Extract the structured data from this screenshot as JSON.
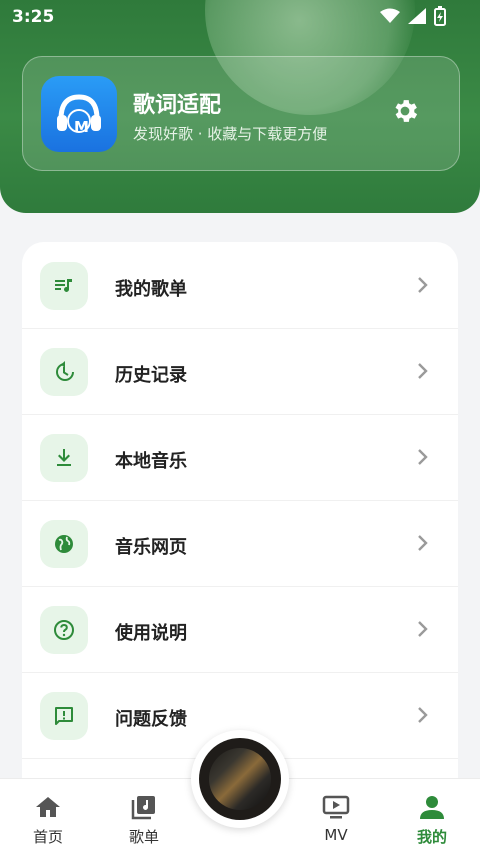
{
  "status_bar": {
    "time": "3:25"
  },
  "app": {
    "name": "歌词适配",
    "subtitle": "发现好歌 · 收藏与下载更方便",
    "logo_text": "M"
  },
  "menu": [
    {
      "label": "我的歌单",
      "icon": "playlist-icon"
    },
    {
      "label": "历史记录",
      "icon": "history-icon"
    },
    {
      "label": "本地音乐",
      "icon": "download-icon"
    },
    {
      "label": "音乐网页",
      "icon": "globe-icon"
    },
    {
      "label": "使用说明",
      "icon": "help-icon"
    },
    {
      "label": "问题反馈",
      "icon": "feedback-icon"
    }
  ],
  "bottom_nav": [
    {
      "label": "首页",
      "icon": "home-icon"
    },
    {
      "label": "歌单",
      "icon": "music-library-icon"
    },
    {
      "label": "MV",
      "icon": "tv-icon"
    },
    {
      "label": "我的",
      "icon": "person-icon",
      "active": true
    }
  ],
  "colors": {
    "accent": "#2e8b3a",
    "header_bg": "#3b8a46",
    "icon_bg": "#e7f5e8",
    "logo_bg": "#1f86ee"
  }
}
